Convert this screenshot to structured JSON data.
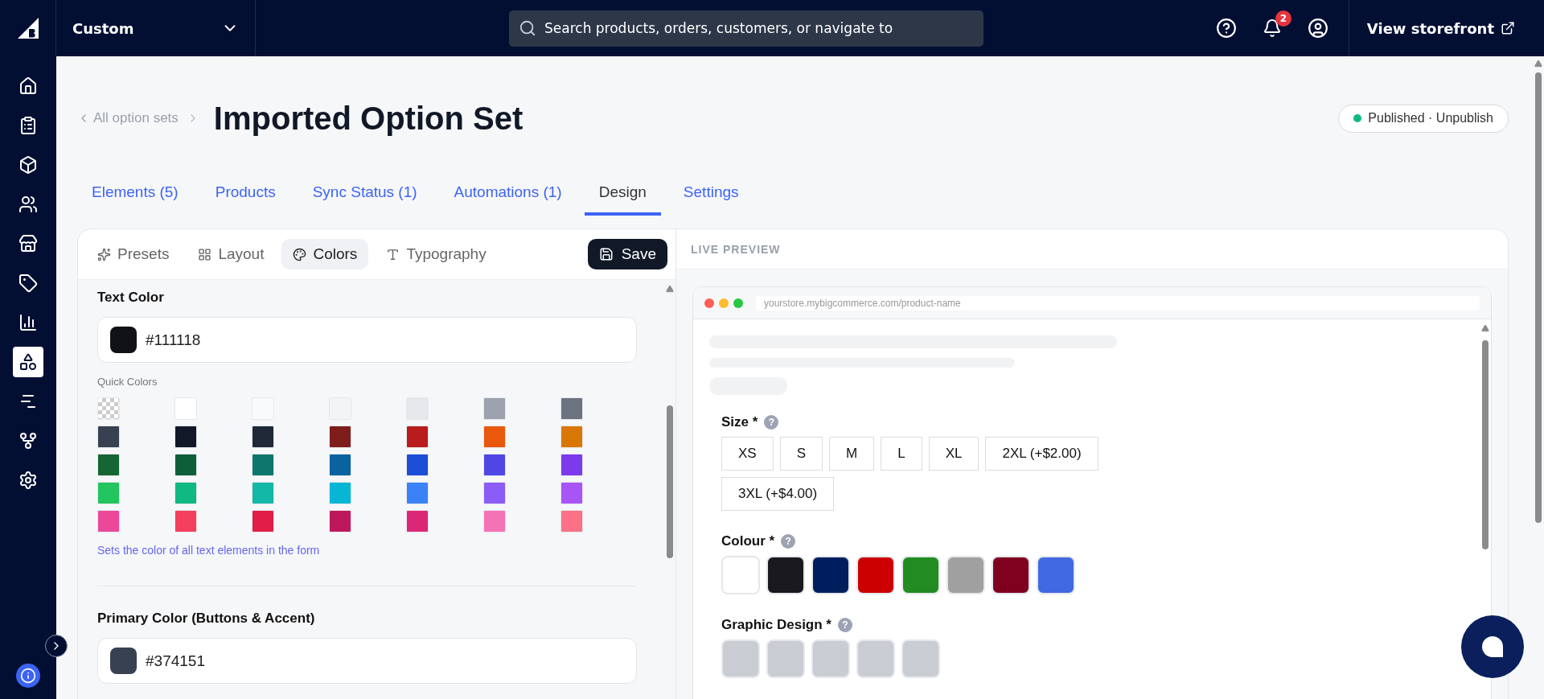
{
  "topbar": {
    "store": "Custom",
    "search": {
      "placeholder": "Search products, orders, customers, or navigate to"
    },
    "notification_count": "2",
    "storefront_link": "View storefront"
  },
  "sidebar": {
    "items": [
      {
        "kind": "home",
        "selected": false
      },
      {
        "kind": "orders",
        "selected": false
      },
      {
        "kind": "products",
        "selected": false
      },
      {
        "kind": "customers",
        "selected": false
      },
      {
        "kind": "storefront",
        "selected": false
      },
      {
        "kind": "marketing",
        "selected": false
      },
      {
        "kind": "analytics",
        "selected": false
      },
      {
        "kind": "apps",
        "selected": true
      },
      {
        "kind": "channels",
        "selected": false
      },
      {
        "kind": "integrations",
        "selected": false
      },
      {
        "kind": "settings",
        "selected": false
      }
    ]
  },
  "header": {
    "breadcrumb": "All option sets",
    "title": "Imported Option Set",
    "status": {
      "label": "Published",
      "separator": "·",
      "action": "Unpublish",
      "published": true
    }
  },
  "tabs": [
    {
      "label": "Elements (5)",
      "selected": false
    },
    {
      "label": "Products",
      "selected": false
    },
    {
      "label": "Sync Status (1)",
      "selected": false
    },
    {
      "label": "Automations (1)",
      "selected": false
    },
    {
      "label": "Design",
      "selected": true
    },
    {
      "label": "Settings",
      "selected": false
    }
  ],
  "editor": {
    "tabs": [
      {
        "kind": "presets",
        "label": "Presets",
        "selected": false
      },
      {
        "kind": "layout",
        "label": "Layout",
        "selected": false
      },
      {
        "kind": "colors",
        "label": "Colors",
        "selected": true
      },
      {
        "kind": "typography",
        "label": "Typography",
        "selected": false
      }
    ],
    "save": "Save",
    "sections": [
      {
        "title": "Text Color",
        "value": "#111118",
        "color": "#111118",
        "quick_colors_label": "Quick Colors",
        "quick_colors": [
          {
            "kind": "transparent"
          },
          {
            "kind": "solid",
            "color": "#ffffff"
          },
          {
            "kind": "solid",
            "color": "#f9fafb"
          },
          {
            "kind": "solid",
            "color": "#f3f4f6"
          },
          {
            "kind": "solid",
            "color": "#e5e7eb"
          },
          {
            "kind": "solid",
            "color": "#9ca3af"
          },
          {
            "kind": "solid",
            "color": "#6b7280"
          },
          {
            "kind": "solid",
            "color": "#374151"
          },
          {
            "kind": "solid",
            "color": "#111827"
          },
          {
            "kind": "solid",
            "color": "#1f2937"
          },
          {
            "kind": "solid",
            "color": "#7f1d1d"
          },
          {
            "kind": "solid",
            "color": "#b91c1c"
          },
          {
            "kind": "solid",
            "color": "#ea580c"
          },
          {
            "kind": "solid",
            "color": "#d97706"
          },
          {
            "kind": "solid",
            "color": "#166534"
          },
          {
            "kind": "solid",
            "color": "#0f5e3a"
          },
          {
            "kind": "solid",
            "color": "#0f766e"
          },
          {
            "kind": "solid",
            "color": "#0a63a0"
          },
          {
            "kind": "solid",
            "color": "#1d4ed8"
          },
          {
            "kind": "solid",
            "color": "#4f46e5"
          },
          {
            "kind": "solid",
            "color": "#7c3aed"
          },
          {
            "kind": "solid",
            "color": "#22c55e"
          },
          {
            "kind": "solid",
            "color": "#10b981"
          },
          {
            "kind": "solid",
            "color": "#14b8a6"
          },
          {
            "kind": "solid",
            "color": "#06b6d4"
          },
          {
            "kind": "solid",
            "color": "#3b82f6"
          },
          {
            "kind": "solid",
            "color": "#8b5cf6"
          },
          {
            "kind": "solid",
            "color": "#a855f7"
          },
          {
            "kind": "solid",
            "color": "#ec4899"
          },
          {
            "kind": "solid",
            "color": "#f43f5e"
          },
          {
            "kind": "solid",
            "color": "#e11d48"
          },
          {
            "kind": "solid",
            "color": "#be185d"
          },
          {
            "kind": "solid",
            "color": "#db2777"
          },
          {
            "kind": "solid",
            "color": "#f472b6"
          },
          {
            "kind": "solid",
            "color": "#fb7185"
          }
        ],
        "hint": "Sets the color of all text elements in the form"
      },
      {
        "title": "Primary Color (Buttons & Accent)",
        "value": "#374151",
        "color": "#374151"
      }
    ]
  },
  "preview": {
    "title": "LIVE PREVIEW",
    "url": "yourstore.mybigcommerce.com/product-name",
    "options": [
      {
        "kind": "buttons",
        "label": "Size *",
        "help": "?",
        "values": [
          "XS",
          "S",
          "M",
          "L",
          "XL",
          "2XL (+$2.00)",
          "3XL (+$4.00)"
        ]
      },
      {
        "kind": "swatches",
        "label": "Colour *",
        "help": "?",
        "colors": [
          {
            "color": "#ffffff"
          },
          {
            "color": "#1a1a1e"
          },
          {
            "color": "#001e5e"
          },
          {
            "color": "#cc0000"
          },
          {
            "color": "#228b22"
          },
          {
            "color": "#a0a0a0"
          },
          {
            "color": "#800020"
          },
          {
            "color": "#4169e1"
          }
        ]
      },
      {
        "kind": "images",
        "label": "Graphic Design *",
        "help": "?",
        "images": [
          {
            "kind": "photo"
          },
          {
            "kind": "photo"
          },
          {
            "kind": "photo"
          },
          {
            "kind": "photo"
          },
          {
            "kind": "photo"
          }
        ]
      }
    ]
  }
}
